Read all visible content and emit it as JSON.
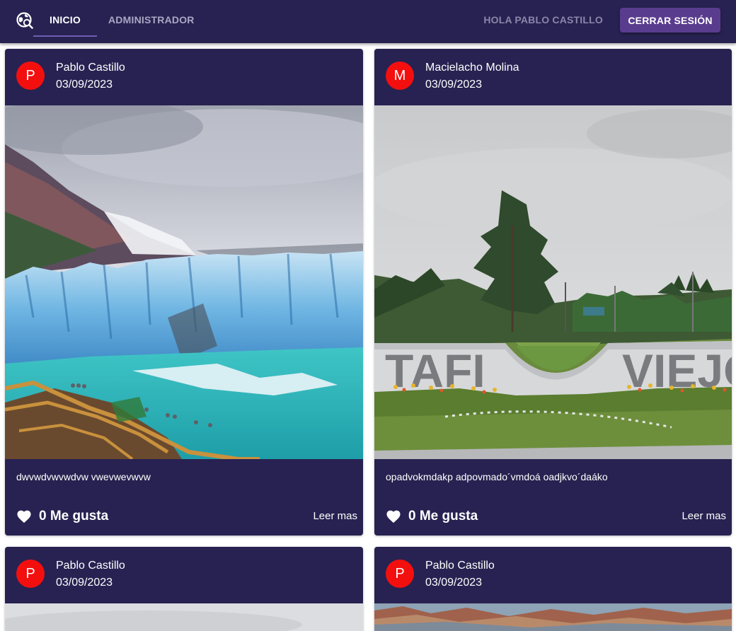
{
  "nav": {
    "logo_icon": "globe-search-icon",
    "tabs": [
      {
        "label": "INICIO",
        "active": true
      },
      {
        "label": "ADMINISTRADOR",
        "active": false
      }
    ],
    "greeting": "HOLA PABLO CASTILLO",
    "logout_label": "CERRAR SESIÓN"
  },
  "colors": {
    "appbar": "#272251",
    "card": "#272251",
    "accent_button": "#5a3c8e",
    "avatar": "#f40f0f"
  },
  "posts": [
    {
      "avatar_letter": "P",
      "author": "Pablo Castillo",
      "date": "03/09/2023",
      "image_icon": "glacier-photo",
      "text": "dwvwdvwvwdvw vwevwevwvw",
      "likes_label": "0 Me gusta",
      "read_more": "Leer mas"
    },
    {
      "avatar_letter": "M",
      "author": "Macielacho Molina",
      "date": "03/09/2023",
      "image_icon": "tafi-viejo-sign-photo",
      "text": "opadvokmdakp adpovmado´vmdoá oadjkvo´daáko",
      "likes_label": "0 Me gusta",
      "read_more": "Leer mas"
    },
    {
      "avatar_letter": "P",
      "author": "Pablo Castillo",
      "date": "03/09/2023",
      "image_icon": "landscape-photo"
    },
    {
      "avatar_letter": "P",
      "author": "Pablo Castillo",
      "date": "03/09/2023",
      "image_icon": "mountains-photo"
    }
  ]
}
